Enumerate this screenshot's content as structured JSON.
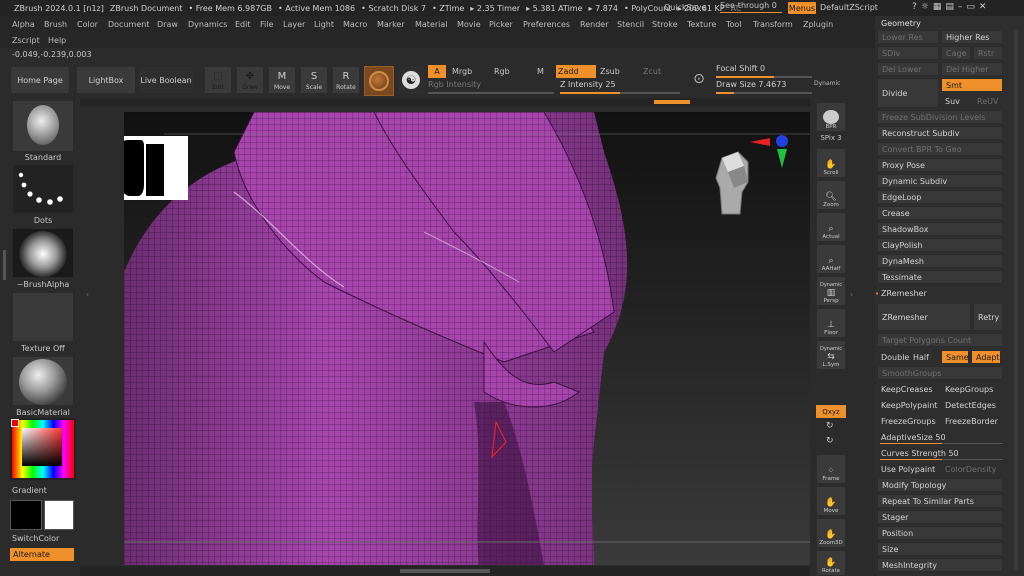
{
  "titlebar": {
    "items": [
      "ZBrush 2024.0.1 [n1z]",
      "ZBrush Document",
      "• Free Mem 6.987GB",
      "• Active Mem 1086",
      "• Scratch Disk 7",
      "• ZTime",
      "▸ 2.35 Timer",
      "▸ 5.381 ATime",
      "▸ 7.874",
      "• PolyCount",
      "▸ 202.61 KP",
      "AC"
    ],
    "quicksave": "QuickSave",
    "seethrough": "See-through  0",
    "menus": "Menus",
    "zscript": "DefaultZScript"
  },
  "menubar": {
    "row1": [
      "Alpha",
      "Brush",
      "Color",
      "Document",
      "Draw",
      "Dynamics",
      "Edit",
      "File",
      "Layer",
      "Light",
      "Macro",
      "Marker",
      "Material",
      "Movie",
      "Picker",
      "Preferences",
      "Render",
      "Stencil",
      "Stroke",
      "Texture",
      "Tool",
      "Transform",
      "Zplugin"
    ],
    "row2": [
      "Zscript",
      "Help"
    ]
  },
  "coords": "-0.049,-0.239,0.003",
  "toolbar": {
    "home": "Home Page",
    "lightbox": "LightBox",
    "liveboolean": "Live Boolean",
    "edit": "Edit",
    "draw": "Draw",
    "move": "Move",
    "scale": "Scale",
    "rotate": "Rotate",
    "a": "A",
    "mrgb": "Mrgb",
    "rgb": "Rgb",
    "m": "M",
    "zadd": "Zadd",
    "zsub": "Zsub",
    "zcut": "Zcut",
    "rgb_intensity": "Rgb Intensity",
    "z_intensity": "Z Intensity 25",
    "focal_shift": "Focal Shift 0",
    "draw_size": "Draw Size 7.4673",
    "dynamic": "Dynamic"
  },
  "leftpanel": {
    "standard": "Standard",
    "dots": "Dots",
    "brushalpha": "~BrushAlpha",
    "textureoff": "Texture Off",
    "basicmaterial": "BasicMaterial",
    "gradient": "Gradient",
    "switchcolor": "SwitchColor",
    "alternate": "Alternate"
  },
  "rightbar": {
    "bpr": "BPR",
    "spix": "SPix 3",
    "scroll": "Scroll",
    "zoom": "Zoom",
    "actual": "Actual",
    "aahalf": "AAHalf",
    "dynamic": "Dynamic",
    "persp": "Persp",
    "floor": "Floor",
    "dynamic2": "Dynamic",
    "lsym": "L.Sym",
    "xyz": "Qxyz",
    "frame": "Frame",
    "move": "Move",
    "zoom3d": "Zoom3D",
    "rotate": "Rotate"
  },
  "geometry": {
    "title": "Geometry",
    "lower_res": "Lower Res",
    "higher_res": "Higher Res",
    "sdiv": "SDiv",
    "cage": "Cage",
    "rstr": "Rstr",
    "del_lower": "Del Lower",
    "del_higher": "Del Higher",
    "divide": "Divide",
    "smt": "Smt",
    "suv": "Suv",
    "reuv": "ReUV",
    "freeze": "Freeze SubDivision Levels",
    "reconstruct": "Reconstruct Subdiv",
    "convert_bpr": "Convert BPR To Geo",
    "proxy": "Proxy Pose",
    "dynamic_subdiv": "Dynamic Subdiv",
    "edgeloop": "EdgeLoop",
    "crease": "Crease",
    "shadowbox": "ShadowBox",
    "claypolish": "ClayPolish",
    "dynamesh": "DynaMesh",
    "tessimate": "Tessimate",
    "zremesher_header": "ZRemesher",
    "zremesher_btn": "ZRemesher",
    "retry": "Retry",
    "target_poly": "Target Polygons Count",
    "double": "Double",
    "half": "Half",
    "same": "Same",
    "adapt": "Adapt",
    "smoothgroups": "SmoothGroups",
    "keepcreases": "KeepCreases",
    "keepgroups": "KeepGroups",
    "keeppolypaint": "KeepPolypaint",
    "detectedges": "DetectEdges",
    "freezegroups": "FreezeGroups",
    "freezeborder": "FreezeBorder",
    "adaptivesize": "AdaptiveSize 50",
    "curves": "Curves Strength 50",
    "usepolypaint": "Use Polypaint",
    "colordensity": "ColorDensity",
    "modify": "Modify Topology",
    "repeat": "Repeat To Similar Parts",
    "stager": "Stager",
    "position": "Position",
    "size": "Size",
    "meshintegrity": "MeshIntegrity"
  },
  "colors": {
    "accent": "#f0902a",
    "mesh": "#a040a8"
  }
}
